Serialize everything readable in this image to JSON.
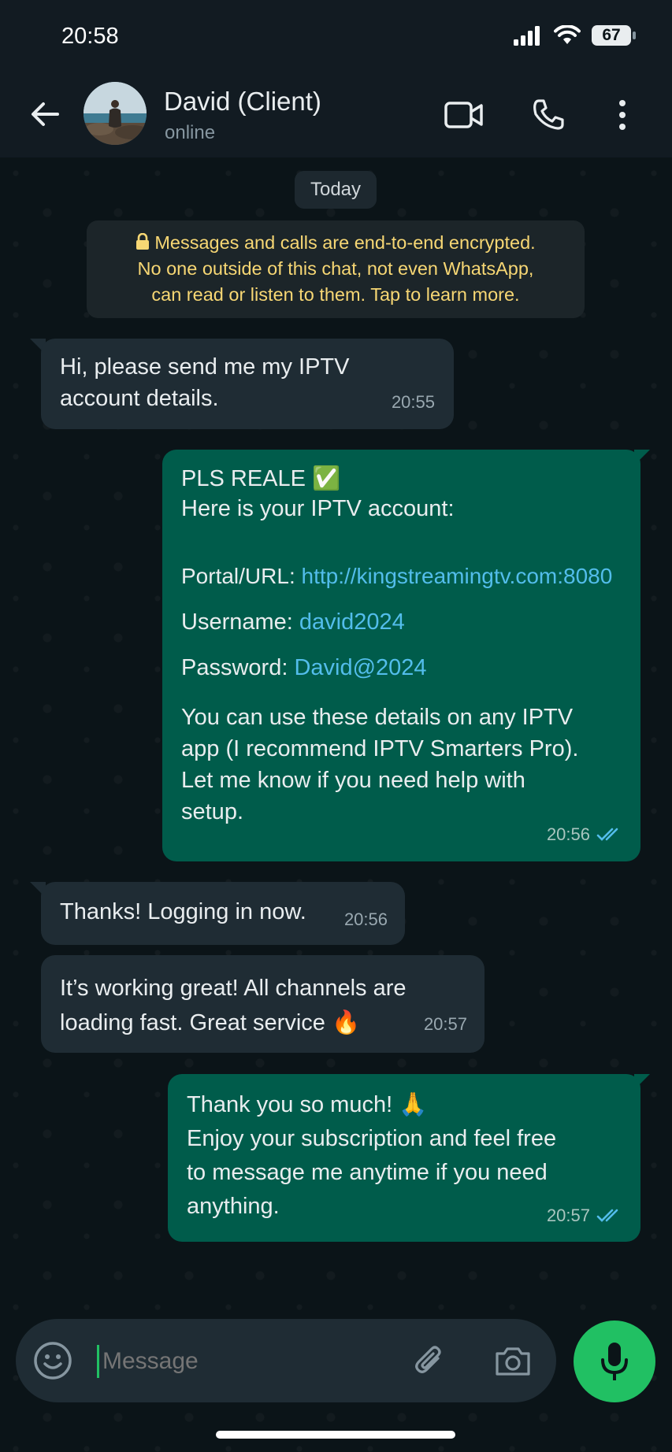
{
  "status_bar": {
    "time": "20:58",
    "battery": "67"
  },
  "header": {
    "contact_name": "David (Client)",
    "contact_status": "online"
  },
  "chat": {
    "date_chip": "Today",
    "encryption_notice": {
      "line1": "Messages and calls are end-to-end encrypted.",
      "line2": "No one outside of this chat, not even WhatsApp,",
      "line3": "can read or listen to them. Tap to learn more."
    },
    "messages": [
      {
        "direction": "incoming",
        "lines": [
          "Hi, please send me my IPTV",
          "account details."
        ],
        "time": "20:55"
      },
      {
        "direction": "outgoing",
        "title": "PLS REALE ✅",
        "intro": "Here is your IPTV account:",
        "portal_label": "Portal/URL: ",
        "portal_value": "http://kingstreamingtv.com:8080",
        "username_label": "Username: ",
        "username_value": "david2024",
        "password_label": "Password: ",
        "password_value": "David@2024",
        "body_lines": [
          "You can use these details on any IPTV",
          "app (I recommend IPTV Smarters Pro).",
          "Let me know if you need help with",
          "setup."
        ],
        "time": "20:56",
        "read": true
      },
      {
        "direction": "incoming",
        "lines": [
          "Thanks! Logging in now."
        ],
        "time": "20:56"
      },
      {
        "direction": "incoming",
        "lines": [
          "It’s working great! All channels are",
          "loading fast. Great service 🔥"
        ],
        "time": "20:57"
      },
      {
        "direction": "outgoing",
        "lines": [
          "Thank you so much! 🙏",
          "Enjoy your subscription and feel free",
          "to message me anytime if you need",
          "anything."
        ],
        "time": "20:57",
        "read": true
      }
    ]
  },
  "composer": {
    "placeholder": "Message"
  },
  "colors": {
    "accent": "#21c063",
    "outgoing_bubble": "#005c4b",
    "incoming_bubble": "#1f2c34",
    "link": "#53bdeb",
    "notice_text": "#f7d774",
    "read_ticks": "#53bdeb"
  }
}
